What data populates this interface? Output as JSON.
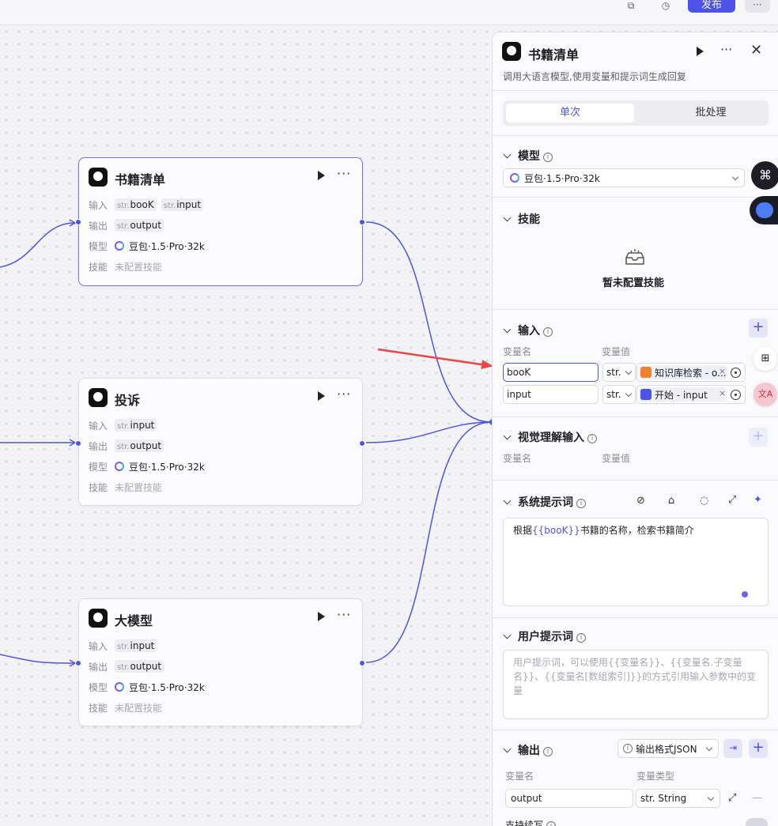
{
  "topbar": {
    "publish_label": "发布",
    "more_label": "···"
  },
  "labels": {
    "input": "输入",
    "output": "输出",
    "model": "模型",
    "skill": "技能",
    "str": "str.",
    "no_skill": "未配置技能"
  },
  "nodes": [
    {
      "title": "书籍清单",
      "inputs": [
        "booK",
        "input"
      ],
      "outputs": [
        "output"
      ],
      "model": "豆包·1.5·Pro·32k"
    },
    {
      "title": "投诉",
      "inputs": [
        "input"
      ],
      "outputs": [
        "output"
      ],
      "model": "豆包·1.5·Pro·32k"
    },
    {
      "title": "大模型",
      "inputs": [
        "input"
      ],
      "outputs": [
        "output"
      ],
      "model": "豆包·1.5·Pro·32k"
    }
  ],
  "panel": {
    "title": "书籍清单",
    "description": "调用大语言模型,使用变量和提示词生成回复",
    "tabs": [
      "单次",
      "批处理"
    ],
    "model_section": {
      "title": "模型",
      "selected": "豆包·1.5·Pro·32k"
    },
    "skills_section": {
      "title": "技能",
      "empty": "暂未配置技能"
    },
    "input_section": {
      "title": "输入",
      "col_name": "变量名",
      "col_value": "变量值",
      "rows": [
        {
          "name": "booK",
          "type": "str.",
          "ref": "知识库检索 - o...",
          "ref_color": "#f0822f"
        },
        {
          "name": "input",
          "type": "str.",
          "ref": "开始 - input",
          "ref_color": "#4d53e8"
        }
      ]
    },
    "vision_section": {
      "title": "视觉理解输入",
      "col_name": "变量名",
      "col_value": "变量值"
    },
    "system_prompt": {
      "title": "系统提示词",
      "before": "根据",
      "var": "{{booK}}",
      "after": "书籍的名称，检索书籍简介"
    },
    "user_prompt": {
      "title": "用户提示词",
      "placeholder": "用户提示词，可以使用{{变量名}}、{{变量名.子变量名}}、{{变量名[数组索引]}}的方式引用输入参数中的变量"
    },
    "output_section": {
      "title": "输出",
      "format_label": "输出格式JSON",
      "col_name": "变量名",
      "col_type": "变量类型",
      "row": {
        "name": "output",
        "type": "str. String"
      },
      "streaming_label": "支持续写"
    }
  },
  "colors": {
    "accent": "#4d53e8",
    "wire": "#4d53e8",
    "arrow": "#f04444"
  }
}
